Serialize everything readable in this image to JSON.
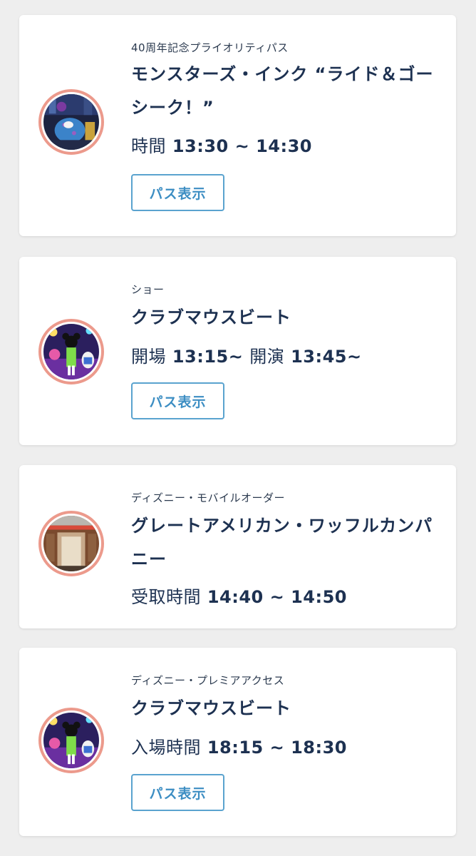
{
  "colors": {
    "background": "#eeeeee",
    "card": "#ffffff",
    "title_text": "#1d3151",
    "button_border": "#5aa3cf",
    "button_text": "#3d8ec3",
    "thumbnail_ring": "#ec9a8c"
  },
  "cards": [
    {
      "category": "40周年記念プライオリティパス",
      "title": "モンスターズ・インク “ライド＆ゴーシーク！”",
      "time_label": "時間",
      "time_value": "13:30 ~ 14:30",
      "button_label": "パス表示",
      "thumbnail": "monsters-inc-ride-image"
    },
    {
      "category": "ショー",
      "title": "クラブマウスビート",
      "time_label": "開場",
      "time_value": "13:15~",
      "time_label_2": "開演",
      "time_value_2": "13:45~",
      "button_label": "パス表示",
      "thumbnail": "club-mouse-beat-show-image"
    },
    {
      "category": "ディズニー・モバイルオーダー",
      "title": "グレートアメリカン・ワッフルカンパニー",
      "time_label": "受取時間",
      "time_value": "14:40 ~ 14:50",
      "thumbnail": "waffle-company-storefront-image"
    },
    {
      "category": "ディズニー・プレミアアクセス",
      "title": "クラブマウスビート",
      "time_label": "入場時間",
      "time_value": "18:15 ~ 18:30",
      "button_label": "パス表示",
      "thumbnail": "club-mouse-beat-show-image"
    }
  ]
}
